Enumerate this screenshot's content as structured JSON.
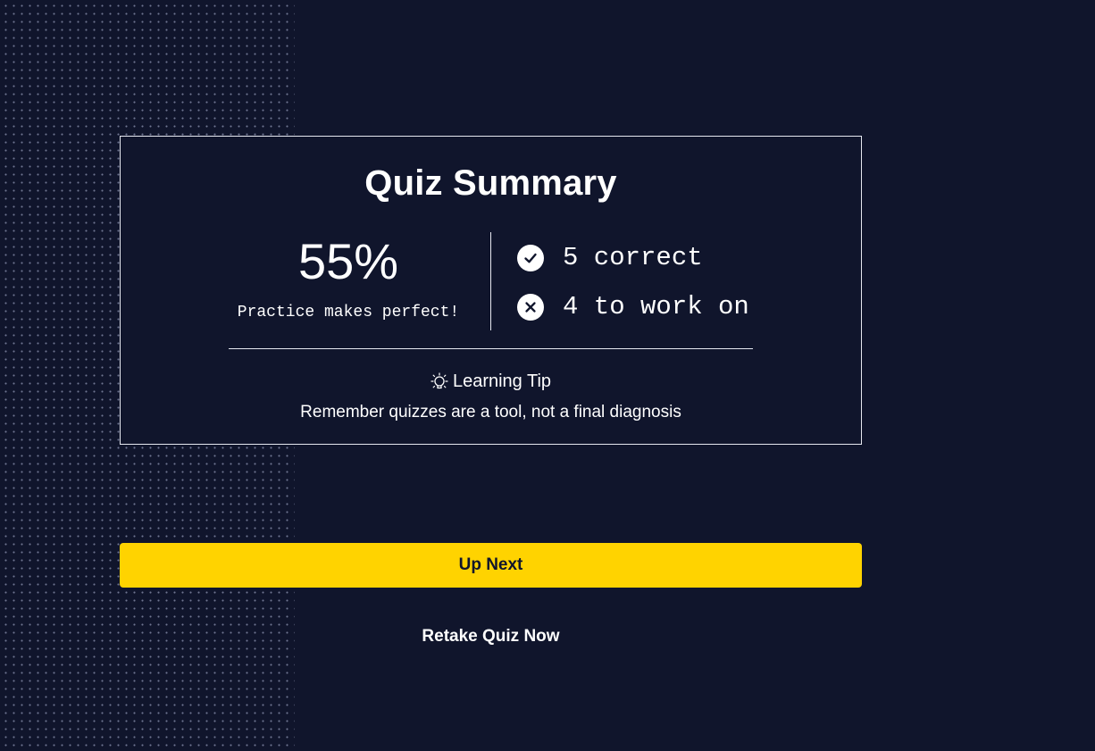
{
  "colors": {
    "background": "#10152c",
    "card_border": "#e6e8f0",
    "accent": "#ffd300",
    "text": "#ffffff"
  },
  "summary": {
    "title": "Quiz Summary",
    "score_percent": "55%",
    "score_value": 55,
    "motto": "Practice makes perfect!",
    "correct_icon": "check-circle-icon",
    "correct_text": "5 correct",
    "correct_count": 5,
    "work_icon": "x-circle-icon",
    "work_text": "4 to work on",
    "work_count": 4
  },
  "tip": {
    "icon": "lightbulb-icon",
    "heading": "Learning Tip",
    "text": "Remember quizzes are a tool, not a final diagnosis"
  },
  "actions": {
    "next_label": "Up Next",
    "retake_label": "Retake Quiz Now"
  }
}
